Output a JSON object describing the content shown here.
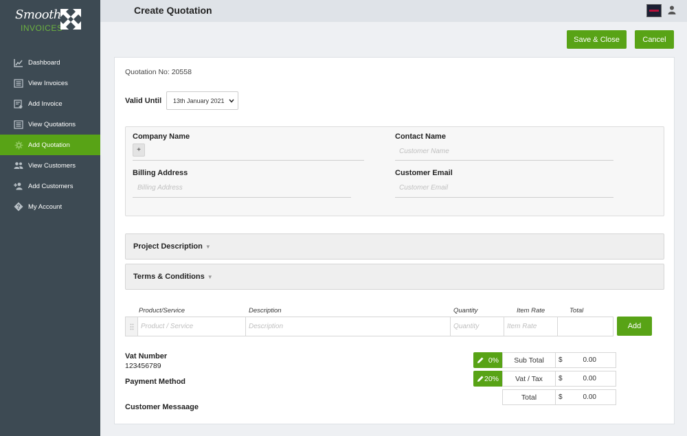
{
  "brand": {
    "logo_top": "Smooth",
    "logo_bottom": "INVOICES"
  },
  "sidebar": {
    "items": [
      {
        "label": "Dashboard",
        "icon": "chart-icon",
        "active": false
      },
      {
        "label": "View Invoices",
        "icon": "list-icon",
        "active": false
      },
      {
        "label": "Add Invoice",
        "icon": "add-document-icon",
        "active": false
      },
      {
        "label": "View Quotations",
        "icon": "list-icon",
        "active": false
      },
      {
        "label": "Add Quotation",
        "icon": "gear-icon",
        "active": true
      },
      {
        "label": "View Customers",
        "icon": "users-icon",
        "active": false
      },
      {
        "label": "Add Customers",
        "icon": "add-user-icon",
        "active": false
      },
      {
        "label": "My Account",
        "icon": "question-diamond-icon",
        "active": false
      }
    ]
  },
  "header": {
    "title": "Create Quotation"
  },
  "actions": {
    "save_close": "Save & Close",
    "cancel": "Cancel"
  },
  "quotation": {
    "number_label": "Quotation No: 20558",
    "valid_until_label": "Valid Until",
    "valid_until_value": "13th January 2021"
  },
  "customer": {
    "company_label": "Company Name",
    "company_add": "+",
    "contact_label": "Contact Name",
    "contact_placeholder": "Customer Name",
    "billing_label": "Billing Address",
    "billing_placeholder": "Billing Address",
    "email_label": "Customer Email",
    "email_placeholder": "Customer Email"
  },
  "sections": {
    "project_description": "Project Description",
    "terms": "Terms & Conditions"
  },
  "items": {
    "headers": {
      "product": "Product/Service",
      "description": "Description",
      "quantity": "Quantity",
      "rate": "Item Rate",
      "total": "Total"
    },
    "placeholders": {
      "product": "Product / Service",
      "description": "Description",
      "quantity": "Quantity",
      "rate": "Item Rate"
    },
    "add_button": "Add"
  },
  "footer": {
    "vat_label": "Vat Number",
    "vat_value": "123456789",
    "payment_label": "Payment Method",
    "message_label": "Customer Messaage"
  },
  "totals": {
    "discount_rate": "0%",
    "tax_rate": "20%",
    "currency": "$",
    "rows": [
      {
        "label": "Sub Total",
        "value": "0.00"
      },
      {
        "label": "Vat / Tax",
        "value": "0.00"
      },
      {
        "label": "Total",
        "value": "0.00"
      }
    ]
  },
  "colors": {
    "sidebar": "#3d4a53",
    "accent": "#58a316",
    "topbar": "#dfe3e8"
  }
}
